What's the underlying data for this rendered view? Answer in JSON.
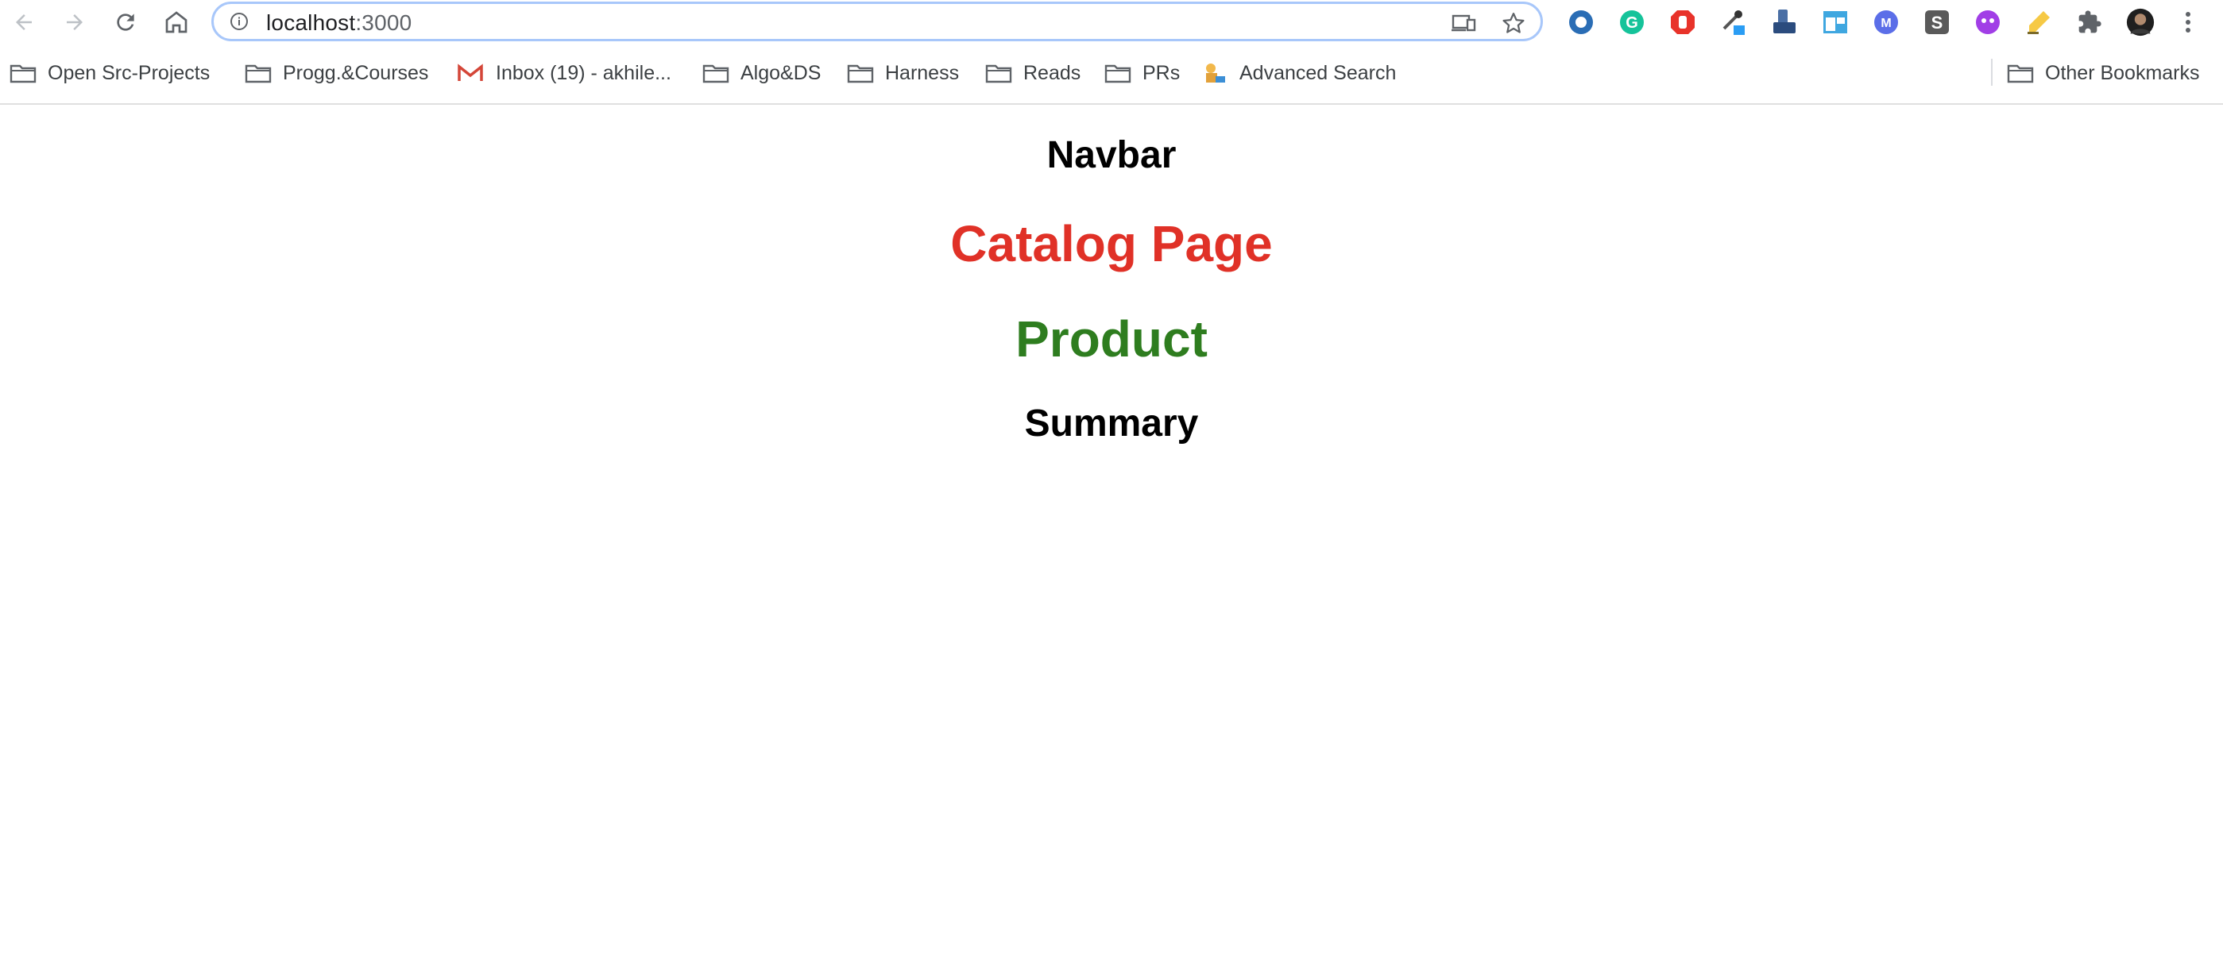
{
  "browser": {
    "address_host": "localhost",
    "address_port": ":3000",
    "bookmarks": [
      {
        "label": "Open Src-Projects",
        "icon": "folder-icon"
      },
      {
        "label": "Progg.&Courses",
        "icon": "folder-icon"
      },
      {
        "label": "Inbox (19) - akhile...",
        "icon": "gmail-icon"
      },
      {
        "label": "Algo&DS",
        "icon": "folder-icon"
      },
      {
        "label": "Harness",
        "icon": "folder-icon"
      },
      {
        "label": "Reads",
        "icon": "folder-icon"
      },
      {
        "label": "PRs",
        "icon": "folder-icon"
      },
      {
        "label": "Advanced Search",
        "icon": "search-bookmark-icon"
      }
    ],
    "other_bookmarks": "Other Bookmarks",
    "extensions": [
      "circle-extension-icon",
      "grammarly-icon",
      "adblock-icon",
      "eyedropper-icon",
      "device-extension-icon",
      "window-extension-icon",
      "m-extension-icon",
      "s-extension-icon",
      "purple-extension-icon",
      "highlighter-icon",
      "puzzle-icon"
    ]
  },
  "page": {
    "navbar": "Navbar",
    "catalog": "Catalog Page",
    "product": "Product",
    "summary": "Summary"
  },
  "colors": {
    "catalog": "#e03127",
    "product": "#2e7d1f",
    "omnibox_border": "#a8c7fa"
  }
}
